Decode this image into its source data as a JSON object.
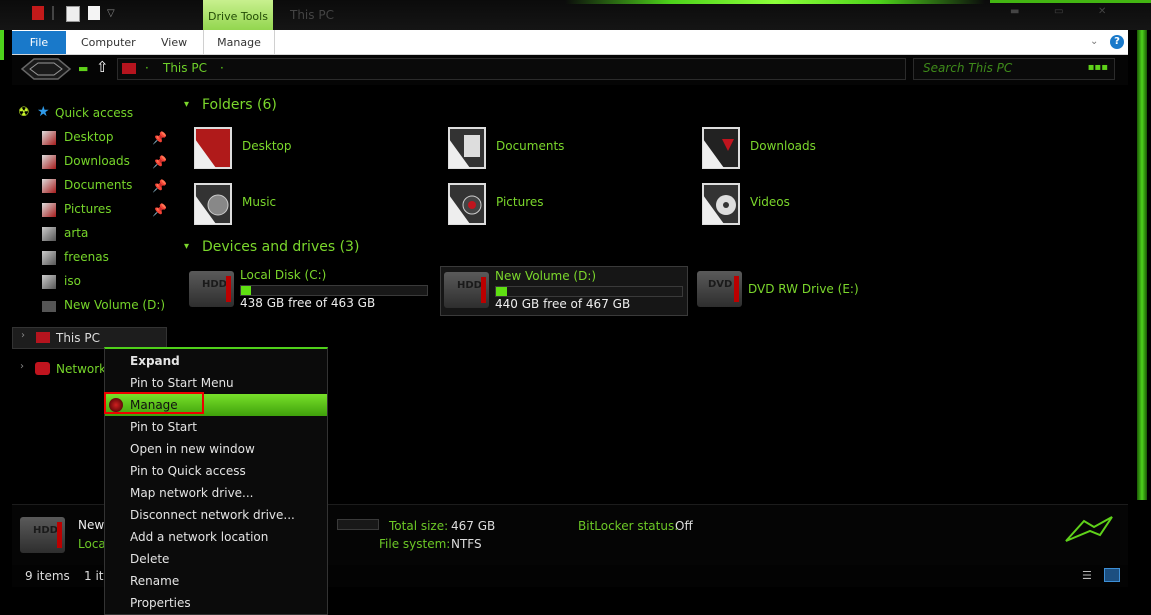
{
  "window": {
    "title": "This PC",
    "context_tab": "Drive Tools"
  },
  "ribbon": {
    "tabs": [
      {
        "label": "File"
      },
      {
        "label": "Computer"
      },
      {
        "label": "View"
      },
      {
        "label": "Manage"
      }
    ],
    "help_label": "?"
  },
  "address": {
    "path": "This PC",
    "search_placeholder": "Search This PC"
  },
  "nav": {
    "quick_access": "Quick access",
    "items": [
      {
        "label": "Desktop",
        "pinned": true
      },
      {
        "label": "Downloads",
        "pinned": true
      },
      {
        "label": "Documents",
        "pinned": true
      },
      {
        "label": "Pictures",
        "pinned": true
      },
      {
        "label": "arta",
        "pinned": false
      },
      {
        "label": "freenas",
        "pinned": false
      },
      {
        "label": "iso",
        "pinned": false
      },
      {
        "label": "New Volume (D:)",
        "pinned": false
      }
    ],
    "this_pc": "This PC",
    "network": "Network"
  },
  "content": {
    "folders_title": "Folders (6)",
    "folders": [
      {
        "label": "Desktop"
      },
      {
        "label": "Documents"
      },
      {
        "label": "Downloads"
      },
      {
        "label": "Music"
      },
      {
        "label": "Pictures"
      },
      {
        "label": "Videos"
      }
    ],
    "devices_title": "Devices and drives (3)",
    "drives": [
      {
        "label": "Local Disk (C:)",
        "free": "438 GB free of 463 GB",
        "used_fraction": 0.054
      },
      {
        "label": "New Volume (D:)",
        "free": "440 GB free of 467 GB",
        "used_fraction": 0.058
      },
      {
        "label": "DVD RW Drive (E:)",
        "free": "",
        "used_fraction": 0
      }
    ]
  },
  "details": {
    "name_partial": "New",
    "type_partial": "Loca",
    "total_size_label": "Total size:",
    "total_size_value": "467 GB",
    "file_system_label": "File system:",
    "file_system_value": "NTFS",
    "bitlocker_label": "BitLocker status:",
    "bitlocker_value": "Off"
  },
  "status": {
    "items_count": "9 items",
    "selected_partial": "1 it"
  },
  "context_menu": {
    "items": [
      {
        "label": "Expand",
        "bold": true
      },
      {
        "label": "Pin to Start Menu"
      },
      {
        "label": "Manage",
        "highlighted": true
      },
      {
        "label": "Pin to Start"
      },
      {
        "label": "Open in new window"
      },
      {
        "label": "Pin to Quick access"
      },
      {
        "label": "Map network drive..."
      },
      {
        "label": "Disconnect network drive..."
      },
      {
        "label": "Add a network location"
      },
      {
        "label": "Delete"
      },
      {
        "label": "Rename"
      },
      {
        "label": "Properties"
      }
    ]
  },
  "colors": {
    "accent_green": "#7bd72c",
    "highlight_red": "#e00000",
    "file_tab_blue": "#1979ca"
  }
}
